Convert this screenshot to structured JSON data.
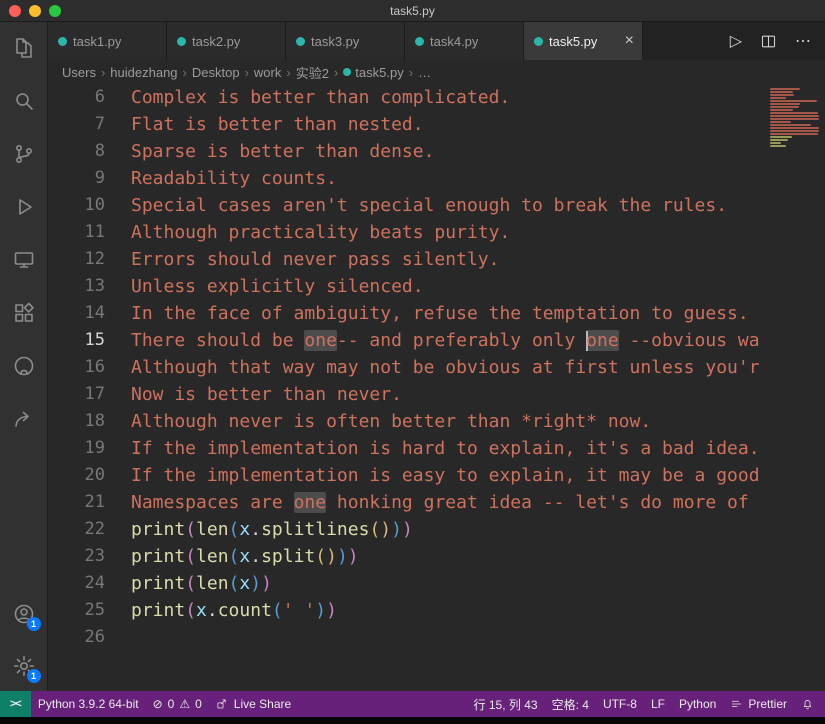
{
  "window": {
    "title": "task5.py"
  },
  "colors": {
    "status_bar_purple": "#68217a",
    "remote_indicator_green": "#0e8068",
    "badge_blue": "#0a7aff",
    "python_file_icon_teal": "#2ab7a9",
    "string_color": "#ce725e"
  },
  "icons": {
    "run": "▷",
    "more_actions": "⋯",
    "close_tab": "×",
    "breadcrumb_separator": "›",
    "remote": "><",
    "error": "⊘",
    "warning": "⚠"
  },
  "tab_bar": {
    "active_index": 4,
    "tabs": [
      {
        "label": "task1.py"
      },
      {
        "label": "task2.py"
      },
      {
        "label": "task3.py"
      },
      {
        "label": "task4.py"
      },
      {
        "label": "task5.py"
      }
    ]
  },
  "breadcrumbs": {
    "items": [
      {
        "label": "Users"
      },
      {
        "label": "huidezhang"
      },
      {
        "label": "Desktop"
      },
      {
        "label": "work"
      },
      {
        "label": "实验2"
      },
      {
        "label": "task5.py",
        "icon": true
      },
      {
        "label": "…"
      }
    ]
  },
  "activity_bar": {
    "items": [
      "explorer",
      "search",
      "source-control",
      "run-and-debug",
      "remote-explorer",
      "extensions",
      "github",
      "live-share",
      "accounts",
      "settings"
    ],
    "accounts_badge": "1",
    "settings_badge": "1"
  },
  "editor": {
    "lines": [
      {
        "num": "6",
        "segs": [
          {
            "t": "Complex is better than complicated.",
            "c": "str"
          }
        ]
      },
      {
        "num": "7",
        "segs": [
          {
            "t": "Flat is better than nested.",
            "c": "str"
          }
        ]
      },
      {
        "num": "8",
        "segs": [
          {
            "t": "Sparse is better than dense.",
            "c": "str"
          }
        ]
      },
      {
        "num": "9",
        "segs": [
          {
            "t": "Readability counts.",
            "c": "str"
          }
        ]
      },
      {
        "num": "10",
        "segs": [
          {
            "t": "Special cases aren't special enough to break the rules.",
            "c": "str"
          }
        ]
      },
      {
        "num": "11",
        "segs": [
          {
            "t": "Although practicality beats purity.",
            "c": "str"
          }
        ]
      },
      {
        "num": "12",
        "segs": [
          {
            "t": "Errors should never pass silently.",
            "c": "str"
          }
        ]
      },
      {
        "num": "13",
        "segs": [
          {
            "t": "Unless explicitly silenced.",
            "c": "str"
          }
        ]
      },
      {
        "num": "14",
        "segs": [
          {
            "t": "In the face of ambiguity, refuse the temptation to guess.",
            "c": "str"
          }
        ]
      },
      {
        "num": "15",
        "current": true,
        "segs": [
          {
            "t": "There should be ",
            "c": "str"
          },
          {
            "t": "one",
            "c": "strhl"
          },
          {
            "t": "-- and preferably only ",
            "c": "str"
          },
          {
            "t": "",
            "c": "cursor"
          },
          {
            "t": "one",
            "c": "strhl"
          },
          {
            "t": " --obvious wa",
            "c": "str"
          }
        ]
      },
      {
        "num": "16",
        "segs": [
          {
            "t": "Although that way may not be obvious at first unless you'r",
            "c": "str"
          }
        ]
      },
      {
        "num": "17",
        "segs": [
          {
            "t": "Now is better than never.",
            "c": "str"
          }
        ]
      },
      {
        "num": "18",
        "segs": [
          {
            "t": "Although never is often better than *right* now.",
            "c": "str"
          }
        ]
      },
      {
        "num": "19",
        "segs": [
          {
            "t": "If the implementation is hard to explain, it's a bad idea.",
            "c": "str"
          }
        ]
      },
      {
        "num": "20",
        "segs": [
          {
            "t": "If the implementation is easy to explain, it may be a good",
            "c": "str"
          }
        ]
      },
      {
        "num": "21",
        "segs": [
          {
            "t": "Namespaces are ",
            "c": "str"
          },
          {
            "t": "one",
            "c": "strhl"
          },
          {
            "t": " honking great idea -- let's do more of",
            "c": "str"
          }
        ]
      },
      {
        "num": "22",
        "segs": [
          {
            "t": "print",
            "c": "fn"
          },
          {
            "t": "(",
            "c": "p1"
          },
          {
            "t": "len",
            "c": "fn"
          },
          {
            "t": "(",
            "c": "p2"
          },
          {
            "t": "x",
            "c": "var"
          },
          {
            "t": ".",
            "c": "pun"
          },
          {
            "t": "splitlines",
            "c": "fn"
          },
          {
            "t": "(",
            "c": "p3"
          },
          {
            "t": ")",
            "c": "p3"
          },
          {
            "t": ")",
            "c": "p2"
          },
          {
            "t": ")",
            "c": "p1"
          }
        ]
      },
      {
        "num": "23",
        "segs": [
          {
            "t": "print",
            "c": "fn"
          },
          {
            "t": "(",
            "c": "p1"
          },
          {
            "t": "len",
            "c": "fn"
          },
          {
            "t": "(",
            "c": "p2"
          },
          {
            "t": "x",
            "c": "var"
          },
          {
            "t": ".",
            "c": "pun"
          },
          {
            "t": "split",
            "c": "fn"
          },
          {
            "t": "(",
            "c": "p3"
          },
          {
            "t": ")",
            "c": "p3"
          },
          {
            "t": ")",
            "c": "p2"
          },
          {
            "t": ")",
            "c": "p1"
          }
        ]
      },
      {
        "num": "24",
        "segs": [
          {
            "t": "print",
            "c": "fn"
          },
          {
            "t": "(",
            "c": "p1"
          },
          {
            "t": "len",
            "c": "fn"
          },
          {
            "t": "(",
            "c": "p2"
          },
          {
            "t": "x",
            "c": "var"
          },
          {
            "t": ")",
            "c": "p2"
          },
          {
            "t": ")",
            "c": "p1"
          }
        ]
      },
      {
        "num": "25",
        "segs": [
          {
            "t": "print",
            "c": "fn"
          },
          {
            "t": "(",
            "c": "p1"
          },
          {
            "t": "x",
            "c": "var"
          },
          {
            "t": ".",
            "c": "pun"
          },
          {
            "t": "count",
            "c": "fn"
          },
          {
            "t": "(",
            "c": "p2"
          },
          {
            "t": "' '",
            "c": "str"
          },
          {
            "t": ")",
            "c": "p2"
          },
          {
            "t": ")",
            "c": "p1"
          }
        ]
      },
      {
        "num": "26",
        "segs": []
      }
    ]
  },
  "status_bar": {
    "remote_label": "><",
    "python_version": "Python 3.9.2 64-bit",
    "error_icon": "⊘",
    "error_count": "0",
    "warning_icon": "⚠",
    "warning_count": "0",
    "live_share_label": "Live Share",
    "cursor_position": "行 15, 列 43",
    "indentation": "空格: 4",
    "encoding": "UTF-8",
    "eol": "LF",
    "language": "Python",
    "formatter": "Prettier"
  }
}
